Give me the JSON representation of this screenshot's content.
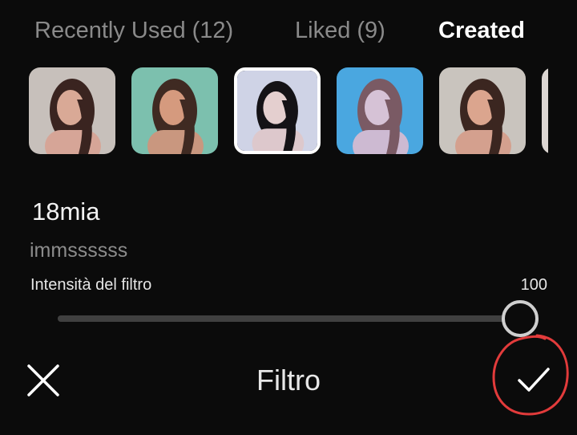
{
  "tabs": [
    {
      "label": "Recently Used (12)",
      "active": false
    },
    {
      "label": "Liked (9)",
      "active": false
    },
    {
      "label": "Created",
      "active": true
    }
  ],
  "thumbnails": [
    {
      "tint": "#b9a8a0",
      "bg": "#c7c0bb"
    },
    {
      "tint": "#86b5a4",
      "bg": "#7cc0ae"
    },
    {
      "tint": "#d8d4da",
      "bg": "#cfd3e6",
      "selected": true
    },
    {
      "tint": "#8fb6d8",
      "bg": "#4aa7e0"
    },
    {
      "tint": "#c3a89d",
      "bg": "#c9c4be"
    }
  ],
  "filter": {
    "name": "18mia",
    "author": "immssssss"
  },
  "intensity": {
    "label": "Intensità del filtro",
    "value_text": "100",
    "value": 100
  },
  "bottom_bar": {
    "title": "Filtro",
    "close_icon": "close-icon",
    "confirm_icon": "checkmark-icon"
  },
  "colors": {
    "background": "#0b0b0b",
    "annotation": "#e23b3b"
  }
}
